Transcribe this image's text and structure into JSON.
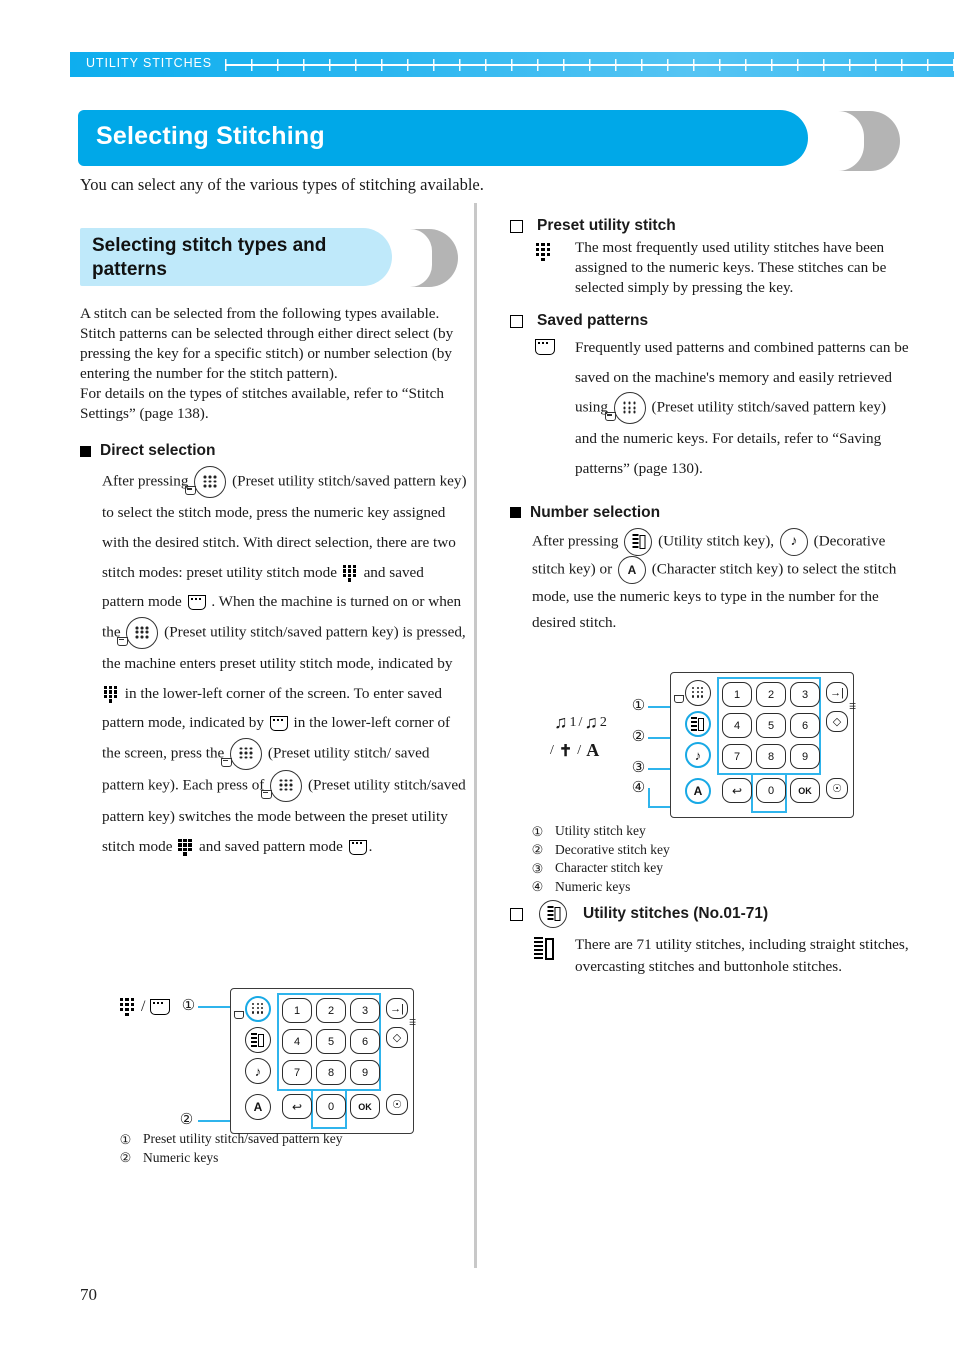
{
  "running_head": {
    "label": "UTILITY STITCHES"
  },
  "chapter": {
    "title": "Selecting Stitching",
    "intro": "You can select any of the various types of stitching available."
  },
  "colors": {
    "header_blue": "#0eaeee",
    "title_blue": "#00a8e8",
    "sub_banner_blue": "#bfe9fa",
    "crescent_gray": "#b4b4b4",
    "callout_blue": "#2fb4ec",
    "divider_gray": "#c8c8c8"
  },
  "left_column": {
    "section_heading": "Selecting stitch types and patterns",
    "intro_paragraph": "A stitch can be selected from the following types available.\nStitch patterns can be selected through either direct select (by pressing the key for a specific stitch) or number selection (by entering the number for the stitch pattern).\nFor details on the types of stitches available, refer to “Stitch Settings” (page 138).",
    "direct_selection": {
      "heading": "Direct selection",
      "text_1": "After pressing",
      "text_2": "(Preset utility stitch/saved pattern key) to select the stitch mode, press the numeric key assigned with the desired stitch. With direct selection, there are two stitch modes: preset utility stitch mode",
      "text_3": "and saved pattern mode",
      "text_4": ". When the machine is turned on or when the",
      "text_5": "(Preset utility stitch/saved pattern key) is pressed, the machine enters preset utility stitch mode, indicated by",
      "text_6": "in the lower-left corner of the screen. To enter saved pattern mode, indicated by",
      "text_7": "in the lower-left corner of the screen, press the",
      "text_8": "(Preset utility stitch/ saved pattern key). Each press of",
      "text_9": "(Preset utility stitch/saved pattern key) switches the mode between the preset utility stitch mode",
      "text_10": "and saved pattern mode",
      "text_11": "."
    },
    "figure": {
      "keys_row1": [
        "1",
        "2",
        "3"
      ],
      "keys_row2": [
        "4",
        "5",
        "6"
      ],
      "keys_row3": [
        "7",
        "8",
        "9"
      ],
      "keys_row4": [
        "A",
        "↩",
        "0",
        "OK"
      ],
      "ok_label": "OK",
      "a_label": "A",
      "zero_label": "0",
      "callout_1": "①",
      "callout_2": "②",
      "legend": [
        {
          "mark": "①",
          "text": "Preset utility stitch/saved pattern key"
        },
        {
          "mark": "②",
          "text": "Numeric keys"
        }
      ]
    }
  },
  "right_column": {
    "preset_utility_stitch": {
      "heading": "Preset utility stitch",
      "body": "The most frequently used utility stitches have been assigned to the numeric keys. These stitches can be selected simply by pressing the key."
    },
    "saved_patterns": {
      "heading": "Saved patterns",
      "body_1": "Frequently used patterns and combined patterns can be saved on the machine's memory and easily retrieved using",
      "body_2": "(Preset utility stitch/saved pattern key) and the numeric keys. For details, refer to “Saving patterns” (page 130)."
    },
    "number_selection": {
      "heading": "Number selection",
      "text_1": "After pressing",
      "text_2": "(Utility stitch key),",
      "text_3": "(Decorative stitch key) or",
      "text_4": "(Character stitch key) to select the stitch mode, use the numeric keys to type in the number for the desired stitch."
    },
    "figure": {
      "stitch_labels": [
        "1",
        "/",
        "2",
        "/",
        "/"
      ],
      "keys_row1": [
        "1",
        "2",
        "3"
      ],
      "keys_row2": [
        "4",
        "5",
        "6"
      ],
      "keys_row3": [
        "7",
        "8",
        "9"
      ],
      "a_label": "A",
      "zero_label": "0",
      "ok_label": "OK",
      "callout_1": "①",
      "callout_2": "②",
      "callout_3": "③",
      "callout_4": "④",
      "legend": [
        {
          "mark": "①",
          "text": "Utility stitch key"
        },
        {
          "mark": "②",
          "text": "Decorative stitch key"
        },
        {
          "mark": "③",
          "text": "Character stitch key"
        },
        {
          "mark": "④",
          "text": "Numeric keys"
        }
      ]
    },
    "utility_stitches": {
      "heading": "Utility stitches (No.01-71)",
      "body": "There are 71 utility stitches, including straight stitches, overcasting stitches and buttonhole stitches."
    }
  },
  "footer": {
    "page_number": "70"
  }
}
